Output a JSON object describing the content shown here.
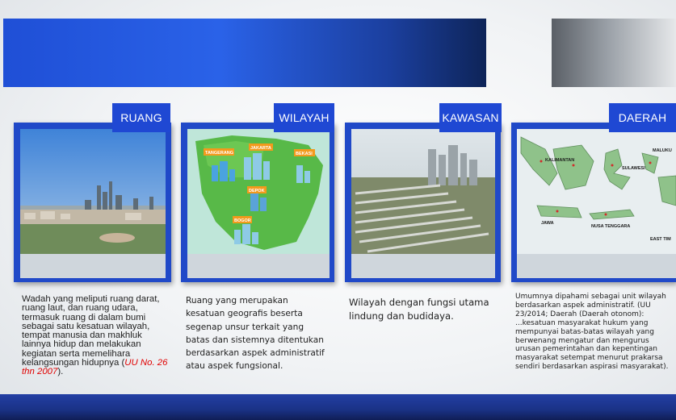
{
  "cards": [
    {
      "title": "RUANG",
      "description": "Wadah yang meliputi ruang darat, ruang laut, dan ruang udara, termasuk ruang di dalam bumi sebagai satu kesatuan wilayah, tempat manusia dan makhluk lainnya hidup dan melakukan kegiatan serta memelihara kelangsungan hidupnya (",
      "reference": "UU No. 26 thn 2007",
      "description_end": ")."
    },
    {
      "title": "WILAYAH",
      "description": "Ruang yang merupakan kesatuan geografis beserta segenap unsur terkait yang batas dan sistemnya ditentukan berdasarkan aspek administratif atau aspek fungsional.",
      "map_labels": [
        "TANGERANG",
        "JAKARTA",
        "BEKASI",
        "DEPOK",
        "BOGOR"
      ]
    },
    {
      "title": "KAWASAN",
      "description": "Wilayah dengan fungsi utama lindung dan budidaya."
    },
    {
      "title": "DAERAH",
      "description": "Umumnya dipahami sebagai unit wilayah berdasarkan aspek administratif. (UU 23/2014; Daerah (Daerah otonom): ...kesatuan masyarakat hukum yang mempunyai batas-batas wilayah yang berwenang mengatur dan mengurus urusan pemerintahan dan kepentingan masyarakat setempat menurut prakarsa sendiri berdasarkan aspirasi masyarakat).",
      "map_labels": [
        "KALIMANTAN",
        "SULAWESI",
        "MALUKU",
        "JAWA",
        "NUSA TENGGARA",
        "EAST TIM"
      ]
    }
  ],
  "colors": {
    "accent_blue": "#1f48d3",
    "reference_red": "#e00000"
  }
}
